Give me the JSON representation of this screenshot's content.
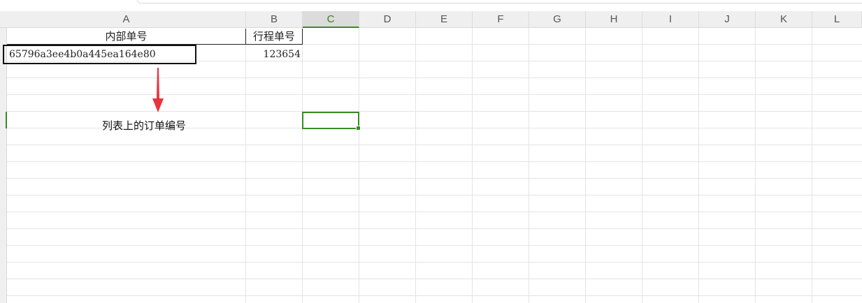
{
  "columns": [
    {
      "id": "A",
      "label": "A"
    },
    {
      "id": "B",
      "label": "B"
    },
    {
      "id": "C",
      "label": "C"
    },
    {
      "id": "D",
      "label": "D"
    },
    {
      "id": "E",
      "label": "E"
    },
    {
      "id": "F",
      "label": "F"
    },
    {
      "id": "G",
      "label": "G"
    },
    {
      "id": "H",
      "label": "H"
    },
    {
      "id": "I",
      "label": "I"
    },
    {
      "id": "J",
      "label": "J"
    },
    {
      "id": "K",
      "label": "K"
    },
    {
      "id": "L",
      "label": "L"
    }
  ],
  "active_column": "C",
  "cells": {
    "A1": "内部单号",
    "B1": "行程单号",
    "A2": "65796a3ee4b0a445ea164e80",
    "B2": "123654"
  },
  "annotation": {
    "text": "列表上的订单编号"
  },
  "colors": {
    "selection": "#3a8a25",
    "arrow": "#e8343f",
    "highlight_border": "#111111"
  }
}
